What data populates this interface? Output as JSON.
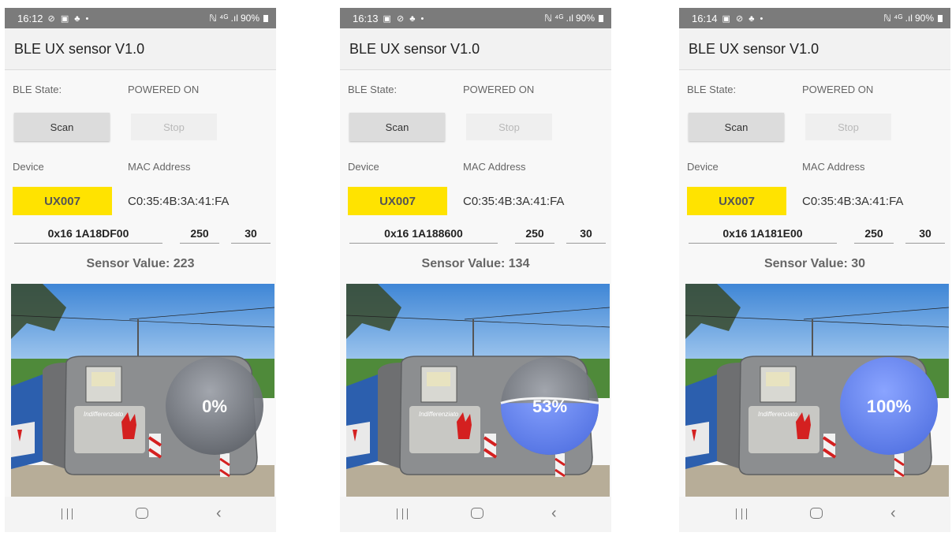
{
  "screens": [
    {
      "status": {
        "time": "16:12",
        "icons": "⊘ ▣ ♣ •",
        "network": "ℕ ⁴ᴳ .ıl",
        "battery": "90%"
      },
      "app_title": "BLE UX sensor V1.0",
      "ble_state_label": "BLE State:",
      "ble_state_value": "POWERED ON",
      "scan_label": "Scan",
      "stop_label": "Stop",
      "device_header": "Device",
      "mac_header": "MAC Address",
      "device_name": "UX007",
      "mac_address": "C0:35:4B:3A:41:FA",
      "field_hex": "0x16 1A18DF00",
      "field_a": "250",
      "field_b": "30",
      "sensor_value": "Sensor Value: 223",
      "fill_percent": 0,
      "fill_label": "0%"
    },
    {
      "status": {
        "time": "16:13",
        "icons": "▣ ⊘ ♣ •",
        "network": "ℕ ⁴ᴳ .ıl",
        "battery": "90%"
      },
      "app_title": "BLE UX sensor V1.0",
      "ble_state_label": "BLE State:",
      "ble_state_value": "POWERED ON",
      "scan_label": "Scan",
      "stop_label": "Stop",
      "device_header": "Device",
      "mac_header": "MAC Address",
      "device_name": "UX007",
      "mac_address": "C0:35:4B:3A:41:FA",
      "field_hex": "0x16 1A188600",
      "field_a": "250",
      "field_b": "30",
      "sensor_value": "Sensor Value: 134",
      "fill_percent": 53,
      "fill_label": "53%"
    },
    {
      "status": {
        "time": "16:14",
        "icons": "▣ ⊘ ♣ •",
        "network": "ℕ ⁴ᴳ .ıl",
        "battery": "90%"
      },
      "app_title": "BLE UX sensor V1.0",
      "ble_state_label": "BLE State:",
      "ble_state_value": "POWERED ON",
      "scan_label": "Scan",
      "stop_label": "Stop",
      "device_header": "Device",
      "mac_header": "MAC Address",
      "device_name": "UX007",
      "mac_address": "C0:35:4B:3A:41:FA",
      "field_hex": "0x16 1A181E00",
      "field_a": "250",
      "field_b": "30",
      "sensor_value": "Sensor Value: 30",
      "fill_percent": 100,
      "fill_label": "100%"
    }
  ],
  "bin_label": "Indifferenziato",
  "colors": {
    "device_chip": "#ffe300",
    "gauge_fill": "#4f6fe0",
    "gauge_empty": "#8a8f99"
  },
  "icons": {
    "recent": "recent-apps-icon",
    "home": "home-icon",
    "back": "back-icon"
  }
}
